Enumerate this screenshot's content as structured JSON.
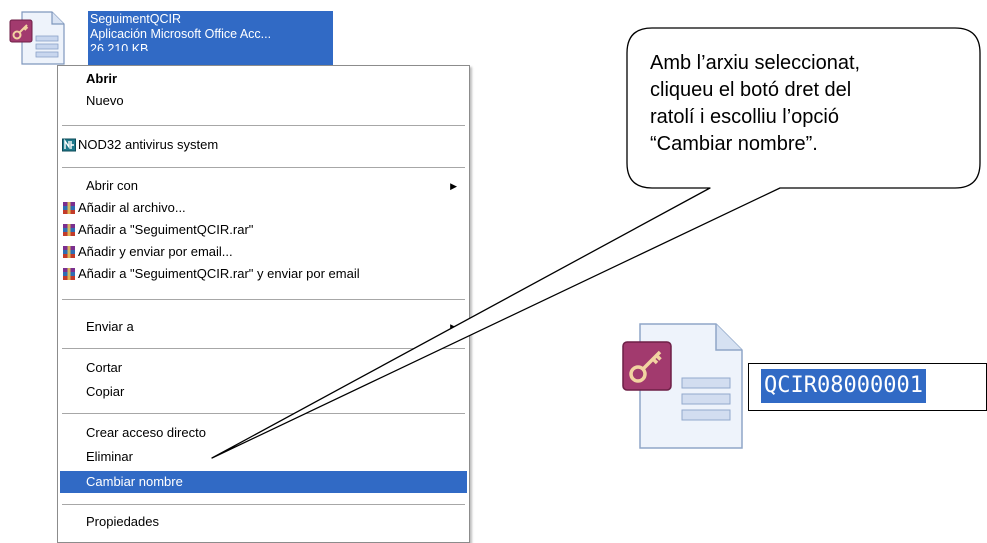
{
  "file": {
    "name": "SeguimentQCIR",
    "type": "Aplicación Microsoft Office Acc...",
    "size": "26.210 KB"
  },
  "context_menu": {
    "items": [
      {
        "label": "Abrir",
        "bold": true
      },
      {
        "label": "Nuevo"
      },
      {
        "label": "NOD32 antivirus system",
        "icon": "nod32-icon"
      },
      {
        "label": "Abrir con",
        "submenu": true
      },
      {
        "label": "Añadir al archivo...",
        "icon": "winrar-icon"
      },
      {
        "label": "Añadir a \"SeguimentQCIR.rar\"",
        "icon": "winrar-icon"
      },
      {
        "label": "Añadir y enviar por email...",
        "icon": "winrar-icon"
      },
      {
        "label": "Añadir a \"SeguimentQCIR.rar\" y enviar por email",
        "icon": "winrar-icon"
      },
      {
        "label": "Enviar a",
        "submenu": true
      },
      {
        "label": "Cortar"
      },
      {
        "label": "Copiar"
      },
      {
        "label": "Crear acceso directo"
      },
      {
        "label": "Eliminar"
      },
      {
        "label": "Cambiar nombre",
        "selected": true
      },
      {
        "label": "Propiedades"
      }
    ],
    "submenu_arrow": "▶"
  },
  "callout": {
    "lines": [
      "Amb l’arxiu seleccionat,",
      "cliqueu el botó dret del",
      "ratolí i escolliu l’opció",
      "“Cambiar nombre”."
    ]
  },
  "rename": {
    "value": "QCIR08000001"
  },
  "colors": {
    "selection": "#316ac5",
    "menu_border": "#8c8c8c"
  }
}
